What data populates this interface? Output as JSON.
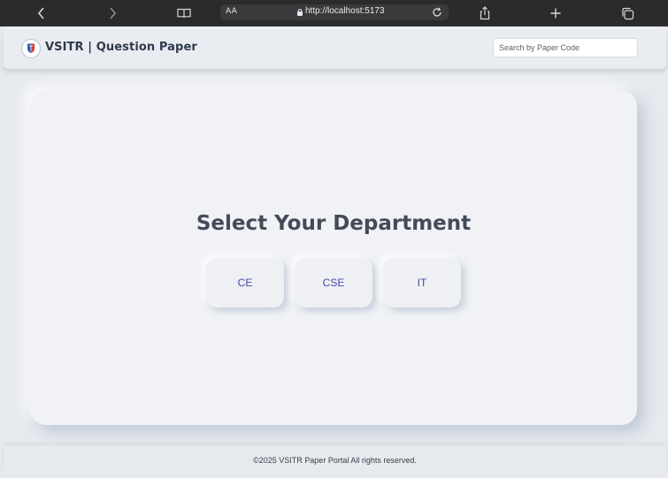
{
  "browser": {
    "text_size_label": "AA",
    "url": "http://localhost:5173",
    "icons": [
      "back-icon",
      "forward-icon",
      "reader-icon",
      "lock-icon",
      "reload-icon",
      "share-icon",
      "new-tab-icon",
      "tabs-icon"
    ]
  },
  "header": {
    "brand": "VSITR | Question Paper",
    "search_placeholder": "Search by Paper Code"
  },
  "main": {
    "title": "Select Your Department",
    "departments": [
      "CE",
      "CSE",
      "IT"
    ]
  },
  "footer": {
    "text": "©2025 VSITR Paper Portal All rights reserved."
  },
  "colors": {
    "background": "#e6e9ee",
    "card": "#f0f2f5",
    "title": "#434b59",
    "department_text": "#4a46a8",
    "browser_bar": "#2b2b2d"
  }
}
